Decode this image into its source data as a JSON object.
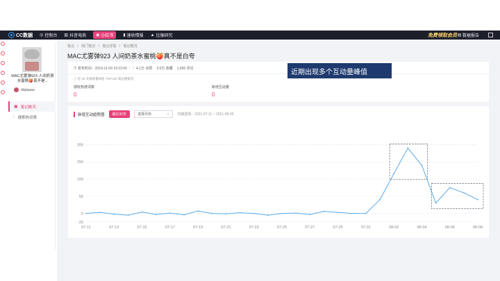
{
  "topbar": {
    "logo": "CC数据",
    "nav": [
      {
        "icon": "dashboard-icon",
        "label": "控制台"
      },
      {
        "icon": "chart-icon",
        "label": "抖音电商"
      },
      {
        "icon": "xiaohongshu-icon",
        "label": "小红书"
      },
      {
        "icon": "bar-icon",
        "label": "速收情报"
      },
      {
        "icon": "research-icon",
        "label": "比猴研究"
      }
    ],
    "promo": "免费领取会员",
    "report": "数据报告"
  },
  "sidebar": {
    "note_title": "MAC尤雾弹923 人间奶茶水蜜桃🍑真不是...",
    "author": "disjiaaaa",
    "menu": [
      {
        "icon": "note-overview-icon",
        "label": "笔记概况"
      },
      {
        "icon": "search-comment-icon",
        "label": "搜索热词表"
      }
    ]
  },
  "breadcrumb": [
    "笔记",
    "/",
    "热门笔记",
    "/",
    "笔记详情",
    "/",
    "笔记概况"
  ],
  "page_title": "MAC尤雾弹923 人间奶茶水蜜桃🍑真不是白夸",
  "meta": {
    "published": "发布时间：2019-11-09 19:22:00",
    "likes": "4.1万 点赞",
    "collects": "2.6万 收藏",
    "comments": "1,656 评论",
    "rank_note": "近 30 天搜索量排名 TOP100 笔记搜索内"
  },
  "stats": [
    {
      "label": "搜收热搜词数",
      "value": "0"
    },
    {
      "label": "新增互动量",
      "value": "0"
    }
  ],
  "chart_panel": {
    "title": "新增互动趋势图",
    "btn_30": "最近30天",
    "month_select": "选择月份",
    "month_select_arrow": "⌄",
    "date_range": "日期选择：2021-07-11 ~ 2021-08-09"
  },
  "annotation": "近期出现多个互动量峰值",
  "chart_data": {
    "type": "line",
    "color": "#5aa9e6",
    "ylim": [
      -25,
      225
    ],
    "yticks": [
      -25,
      0,
      50,
      100,
      150,
      200
    ],
    "ytick_labels": [
      "-25",
      "0",
      "50",
      "100",
      "150",
      "200"
    ],
    "xtick_labels": [
      "07-11",
      "07-13",
      "07-15",
      "07-17",
      "07-19",
      "07-21",
      "07-23",
      "07-25",
      "07-27",
      "07-29",
      "07-31",
      "08-02",
      "08-04",
      "08-06",
      "08-08"
    ],
    "values": [
      0,
      3,
      -2,
      -5,
      4,
      -3,
      1,
      -4,
      7,
      0,
      -1,
      2,
      0,
      -5,
      0,
      1,
      -3,
      6,
      3,
      0,
      0,
      40,
      115,
      190,
      140,
      30,
      75,
      60,
      40
    ],
    "highlight_ranges": [
      [
        22,
        24
      ],
      [
        25,
        28
      ]
    ]
  }
}
